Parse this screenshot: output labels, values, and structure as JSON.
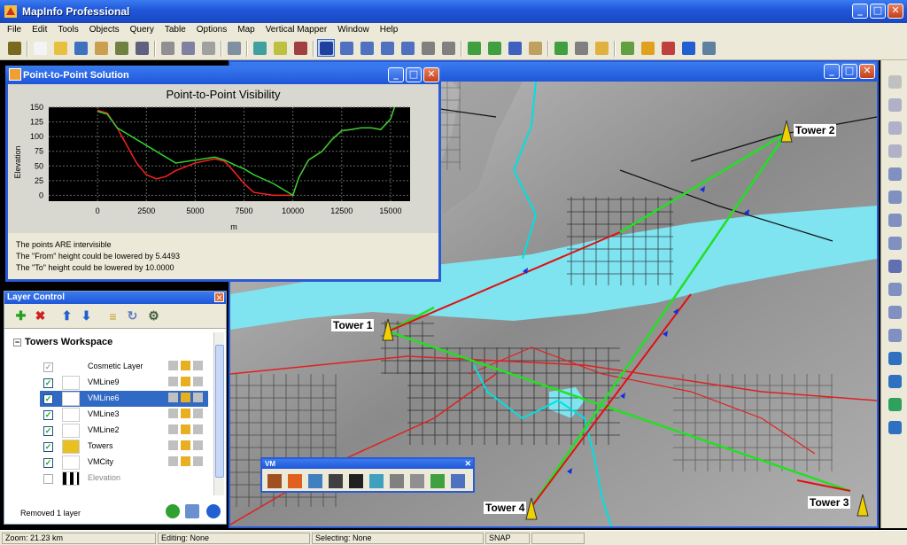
{
  "app": {
    "title": "MapInfo Professional",
    "window_buttons": [
      "_",
      "□",
      "✕"
    ]
  },
  "menu": [
    "File",
    "Edit",
    "Tools",
    "Objects",
    "Query",
    "Table",
    "Options",
    "Map",
    "Vertical Mapper",
    "Window",
    "Help"
  ],
  "toolbar_icons": [
    "hand-icon",
    "new-icon",
    "open-icon",
    "save-icon",
    "open-workspace-icon",
    "save-workspace-icon",
    "print-icon",
    "cut-icon",
    "copy-icon",
    "paste-icon",
    "undo-icon",
    "new-browser-icon",
    "new-mapper-icon",
    "new-grapher-icon",
    "select-arrow-icon",
    "marquee-select-icon",
    "radius-select-icon",
    "polygon-select-icon",
    "boundary-select-icon",
    "unselect-icon",
    "invert-select-icon",
    "zoom-in-icon",
    "zoom-out-icon",
    "change-view-icon",
    "grabber-icon",
    "info-icon",
    "ruler-icon",
    "label-icon",
    "drag-window-icon",
    "layer-control-icon",
    "legend-icon",
    "statistics-icon",
    "help-pointer-icon"
  ],
  "p2p": {
    "window_title": "Point-to-Point Solution",
    "results": [
      "The points ARE intervisible",
      "The \"From\" height could be lowered by 5.4493",
      "The \"To\" height could be lowered by 10.0000"
    ]
  },
  "chart_data": {
    "type": "line",
    "title": "Point-to-Point Visibility",
    "xlabel": "m",
    "ylabel": "Elevation",
    "xlim": [
      -2500,
      16000
    ],
    "ylim": [
      -10,
      150
    ],
    "xticks": [
      0,
      2500,
      5000,
      7500,
      10000,
      12500,
      15000
    ],
    "yticks": [
      0,
      25,
      50,
      75,
      100,
      125,
      150
    ],
    "grid": true,
    "background": "#000000",
    "series": [
      {
        "color": "#ff2020",
        "x": [
          0,
          500,
          1000,
          1500,
          2000,
          2500,
          3000,
          3500,
          4000,
          5000,
          6000,
          6500,
          7000,
          7500,
          8000,
          9000,
          10000,
          10300,
          10800,
          11500,
          12000,
          12500,
          13000,
          13500,
          14000,
          14500,
          15000,
          15200
        ],
        "y": [
          145,
          140,
          115,
          85,
          55,
          35,
          28,
          32,
          42,
          55,
          62,
          58,
          40,
          20,
          5,
          0,
          0,
          30,
          60,
          75,
          95,
          110,
          112,
          115,
          115,
          112,
          130,
          150
        ]
      },
      {
        "color": "#30d030",
        "x": [
          0,
          500,
          1000,
          2000,
          3000,
          4000,
          5000,
          6000,
          6500,
          7000,
          7500,
          8000,
          9000,
          10000,
          10300,
          10800,
          11500,
          12000,
          12500,
          13000,
          13500,
          14000,
          14500,
          15000,
          15200
        ],
        "y": [
          143,
          138,
          115,
          95,
          75,
          55,
          60,
          65,
          60,
          52,
          45,
          35,
          20,
          0,
          30,
          60,
          75,
          95,
          110,
          112,
          115,
          115,
          112,
          130,
          150
        ]
      }
    ]
  },
  "layer_control": {
    "title": "Layer Control",
    "workspace": "Towers Workspace",
    "layers": [
      {
        "name": "Cosmetic Layer",
        "checked": false,
        "selected": false,
        "disabled": false
      },
      {
        "name": "VMLine9",
        "checked": true,
        "selected": false,
        "disabled": false
      },
      {
        "name": "VMLine6",
        "checked": true,
        "selected": true,
        "disabled": false
      },
      {
        "name": "VMLine3",
        "checked": true,
        "selected": false,
        "disabled": false
      },
      {
        "name": "VMLine2",
        "checked": true,
        "selected": false,
        "disabled": false
      },
      {
        "name": "Towers",
        "checked": true,
        "selected": false,
        "disabled": false
      },
      {
        "name": "VMCity",
        "checked": true,
        "selected": false,
        "disabled": false
      },
      {
        "name": "Elevation",
        "checked": false,
        "selected": false,
        "disabled": true
      }
    ],
    "status": "Removed 1 layer"
  },
  "map": {
    "towers": [
      "Tower 1",
      "Tower 2",
      "Tower 3",
      "Tower 4"
    ],
    "colors": {
      "water": "#7fe3f0",
      "green_link": "#22e022",
      "red_link": "#e01010",
      "road": "#e02020",
      "river": "#00e0e0"
    }
  },
  "vm_toolbar": {
    "title": "VM"
  },
  "status": {
    "zoom": "Zoom: 21.23 km",
    "editing": "Editing: None",
    "selecting": "Selecting: None",
    "snap": "SNAP"
  }
}
